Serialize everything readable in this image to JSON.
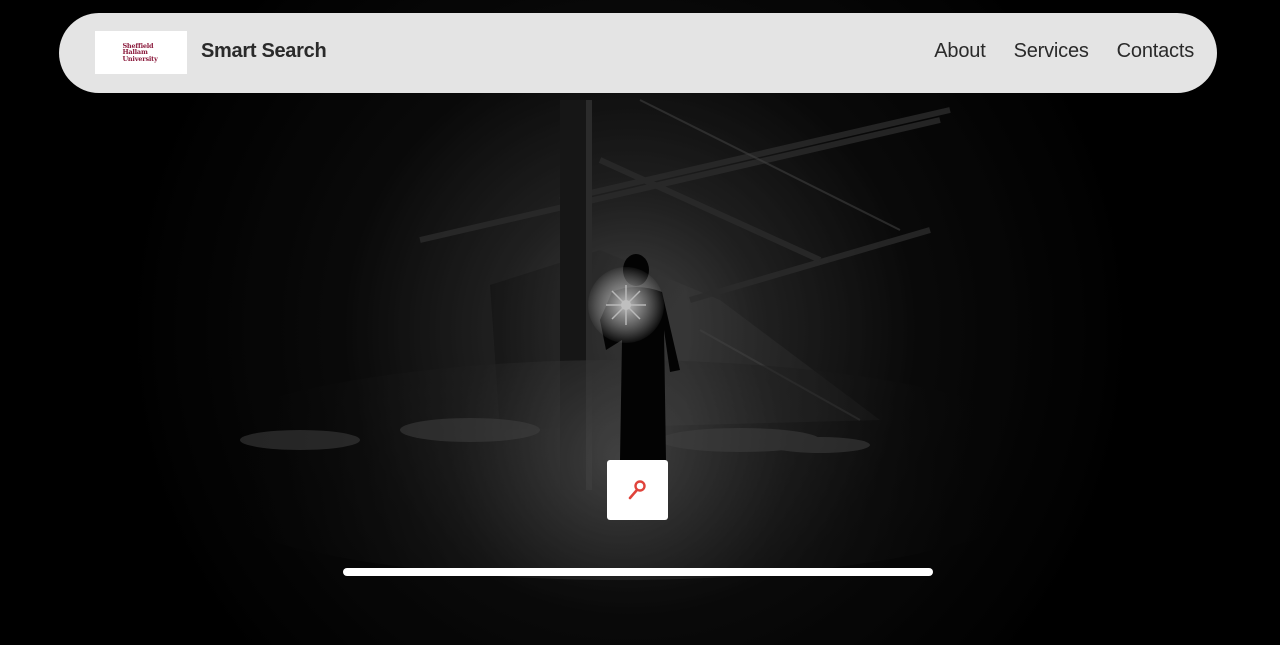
{
  "navbar": {
    "logo_text": "Sheffield\nHallam\nUniversity",
    "brand": "Smart Search",
    "links": [
      "About",
      "Services",
      "Contacts"
    ]
  },
  "hero": {
    "search_button_icon": "search-icon",
    "search_bar_icon": "search-bar-icon"
  },
  "colors": {
    "navbar_bg": "#e4e4e4",
    "logo_color": "#8b1a3c",
    "search_icon_color": "#e0433b",
    "background": "#000000"
  }
}
